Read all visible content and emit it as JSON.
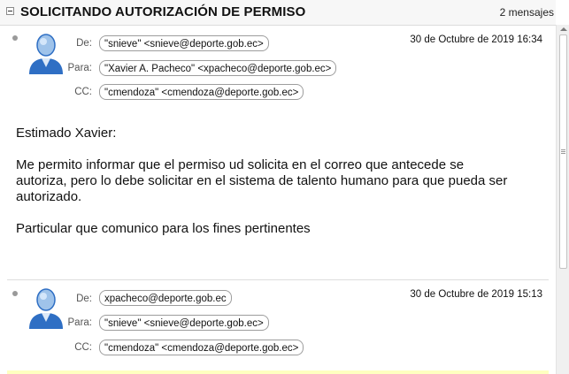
{
  "thread": {
    "subject": "SOLICITANDO AUTORIZACIÓN DE PERMISO",
    "message_count": "2 mensajes"
  },
  "messages": [
    {
      "from_label": "De:",
      "from": "\"snieve\" <snieve@deporte.gob.ec>",
      "to_label": "Para:",
      "to": "\"Xavier A. Pacheco\" <xpacheco@deporte.gob.ec>",
      "cc_label": "CC:",
      "cc": "\"cmendoza\" <cmendoza@deporte.gob.ec>",
      "date": "30 de Octubre de 2019 16:34",
      "body": [
        "Estimado Xavier:",
        "Me permito informar que el permiso ud solicita en el correo que antecede se autoriza, pero lo debe solicitar en el sistema de talento humano para que pueda ser autorizado.",
        "Particular que comunico para los fines pertinentes"
      ]
    },
    {
      "from_label": "De:",
      "from": "xpacheco@deporte.gob.ec",
      "to_label": "Para:",
      "to": "\"snieve\" <snieve@deporte.gob.ec>",
      "cc_label": "CC:",
      "cc": "\"cmendoza\" <cmendoza@deporte.gob.ec>",
      "date": "30 de Octubre de 2019 15:13"
    }
  ],
  "colors": {
    "avatar_blue": "#2f6fc4",
    "avatar_light": "#9fc3ea",
    "pill_border": "#9d9d9d",
    "highlight_strip": "#ffffc0"
  }
}
